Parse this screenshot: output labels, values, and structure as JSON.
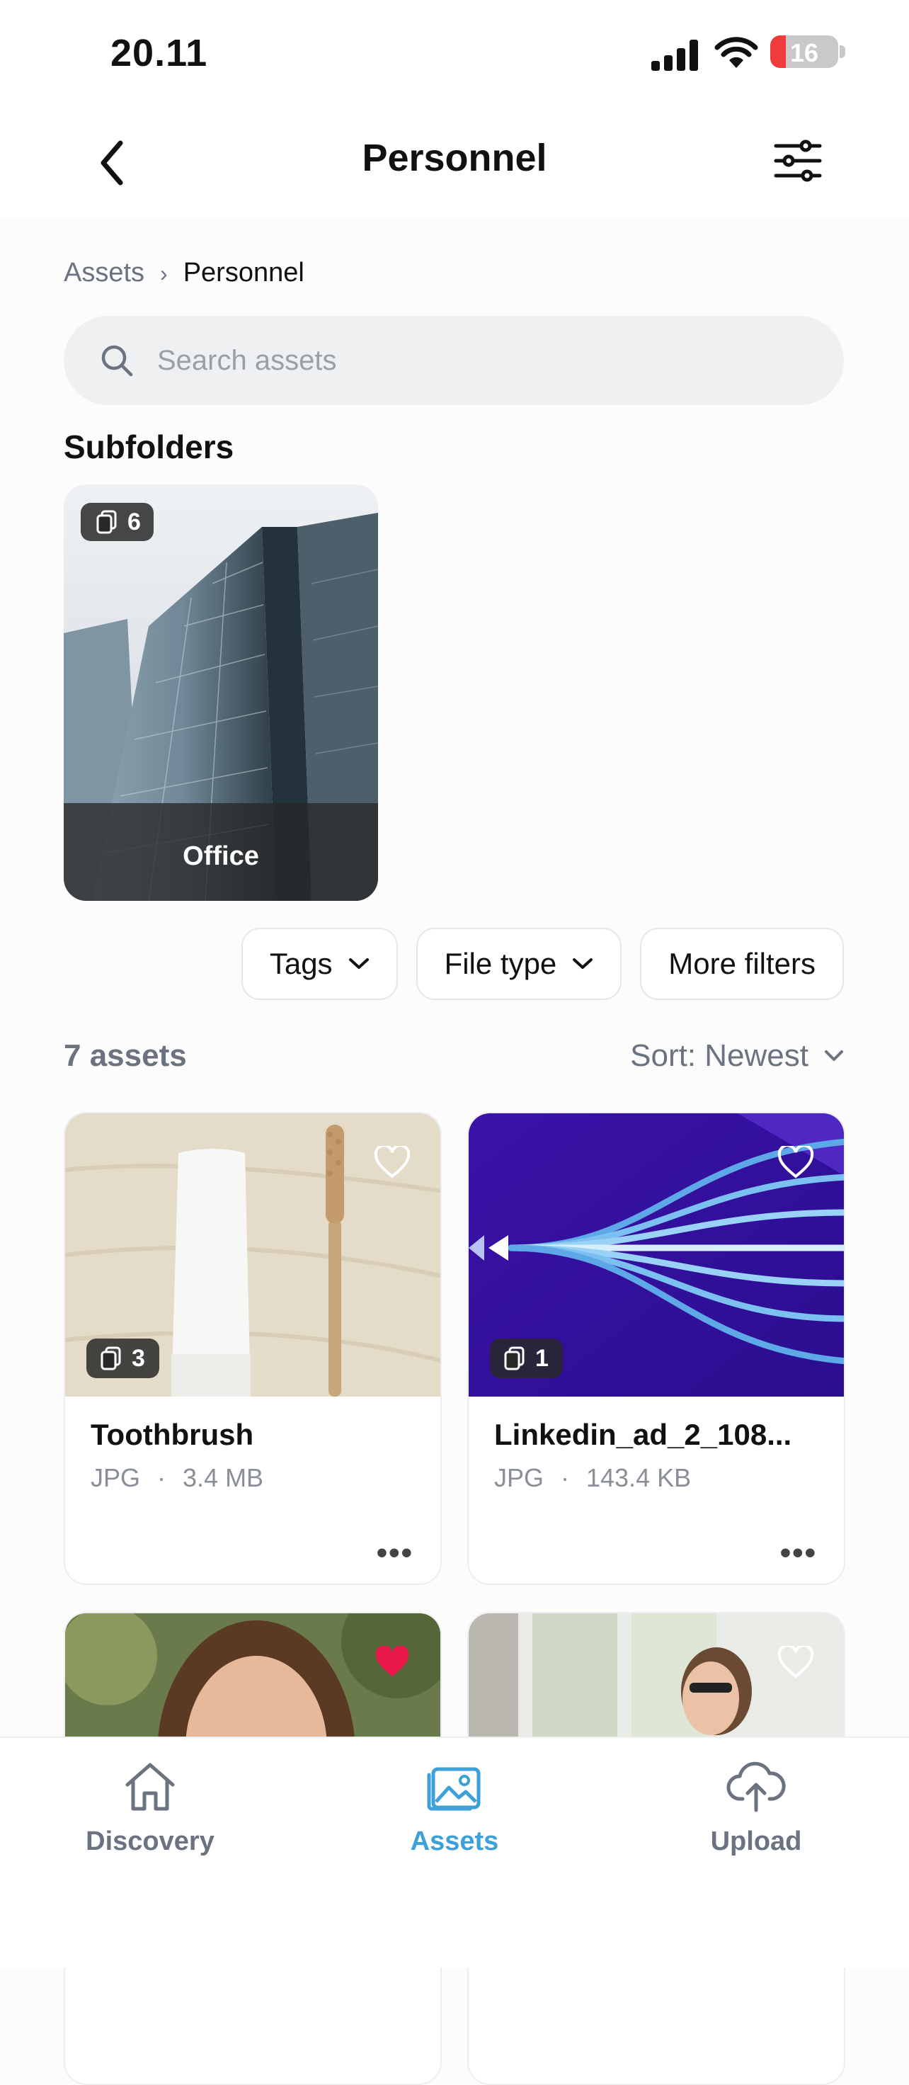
{
  "status": {
    "time": "20.11",
    "battery": "16"
  },
  "header": {
    "title": "Personnel",
    "back_icon": "chevron-left-icon",
    "filter_icon": "sliders-icon"
  },
  "breadcrumb": {
    "root": "Assets",
    "separator": "›",
    "current": "Personnel"
  },
  "search": {
    "placeholder": "Search assets",
    "value": ""
  },
  "subfolders": {
    "heading": "Subfolders",
    "items": [
      {
        "name": "Office",
        "count": "6"
      }
    ]
  },
  "filters": [
    {
      "label": "Tags"
    },
    {
      "label": "File type"
    },
    {
      "label": "More filters"
    }
  ],
  "list": {
    "count_label": "7 assets",
    "sort_label": "Sort: Newest"
  },
  "assets": [
    {
      "name": "Toothbrush",
      "type": "JPG",
      "size": "3.4 MB",
      "count": "3",
      "favorite": false
    },
    {
      "name": "Linkedin_ad_2_108...",
      "type": "JPG",
      "size": "143.4 KB",
      "count": "1",
      "favorite": false
    },
    {
      "favorite": true
    },
    {
      "favorite": false
    }
  ],
  "tabbar": [
    {
      "label": "Discovery",
      "icon": "home-icon"
    },
    {
      "label": "Assets",
      "icon": "image-icon",
      "active": true
    },
    {
      "label": "Upload",
      "icon": "cloud-upload-icon"
    }
  ],
  "colors": {
    "accent": "#3ea0d8",
    "heart_active": "#e8194a"
  }
}
